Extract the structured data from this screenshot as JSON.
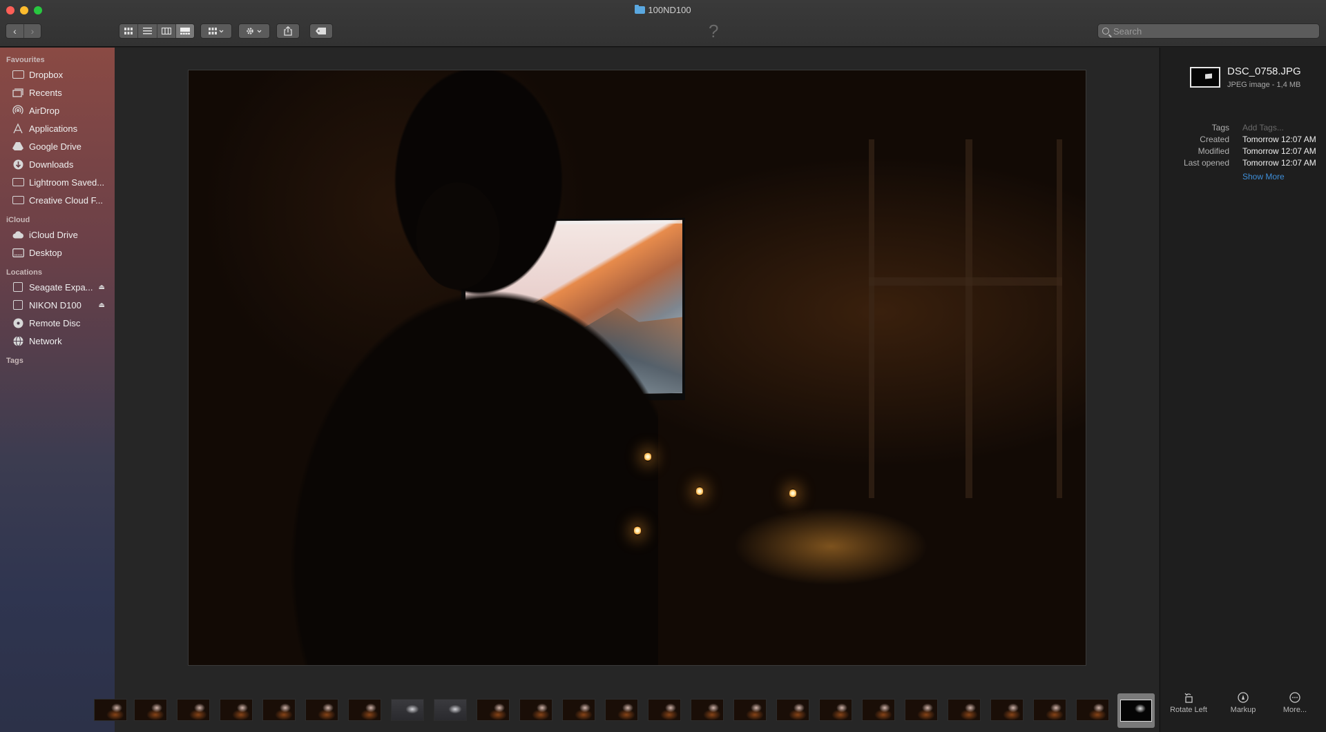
{
  "window": {
    "title": "100ND100"
  },
  "toolbar": {
    "back_label": "‹",
    "forward_label": "›",
    "help_glyph": "?",
    "search": {
      "placeholder": "Search",
      "value": ""
    },
    "view_modes": [
      "icon-view",
      "list-view",
      "column-view",
      "gallery-view"
    ],
    "active_view": "gallery-view"
  },
  "sidebar": {
    "favourites_header": "Favourites",
    "favourites": [
      {
        "label": "Dropbox",
        "icon": "folder-icon"
      },
      {
        "label": "Recents",
        "icon": "recents-icon"
      },
      {
        "label": "AirDrop",
        "icon": "airdrop-icon"
      },
      {
        "label": "Applications",
        "icon": "applications-icon"
      },
      {
        "label": "Google Drive",
        "icon": "google-drive-icon"
      },
      {
        "label": "Downloads",
        "icon": "downloads-icon"
      },
      {
        "label": "Lightroom Saved...",
        "icon": "folder-icon"
      },
      {
        "label": "Creative Cloud F...",
        "icon": "folder-icon"
      }
    ],
    "icloud_header": "iCloud",
    "icloud": [
      {
        "label": "iCloud Drive",
        "icon": "cloud-icon"
      },
      {
        "label": "Desktop",
        "icon": "desktop-icon"
      }
    ],
    "locations_header": "Locations",
    "locations": [
      {
        "label": "Seagate Expa...",
        "icon": "disk-icon",
        "eject": "⏏"
      },
      {
        "label": "NIKON D100",
        "icon": "disk-icon",
        "eject": "⏏"
      },
      {
        "label": "Remote Disc",
        "icon": "disc-icon"
      },
      {
        "label": "Network",
        "icon": "network-icon"
      }
    ],
    "tags_header": "Tags"
  },
  "inspector": {
    "file_name": "DSC_0758.JPG",
    "file_kind": "JPEG image - 1,4 MB",
    "tags_label": "Tags",
    "tags_placeholder": "Add Tags...",
    "created_label": "Created",
    "created_value": "Tomorrow 12:07 AM",
    "modified_label": "Modified",
    "modified_value": "Tomorrow 12:07 AM",
    "last_opened_label": "Last opened",
    "last_opened_value": "Tomorrow 12:07 AM",
    "show_more": "Show More"
  },
  "actions": {
    "rotate_left": "Rotate Left",
    "markup": "Markup",
    "more": "More..."
  },
  "colors": {
    "accent": "#3e8ed8",
    "close": "#fe5f57",
    "minimize": "#febc2e",
    "zoom": "#28c840"
  }
}
